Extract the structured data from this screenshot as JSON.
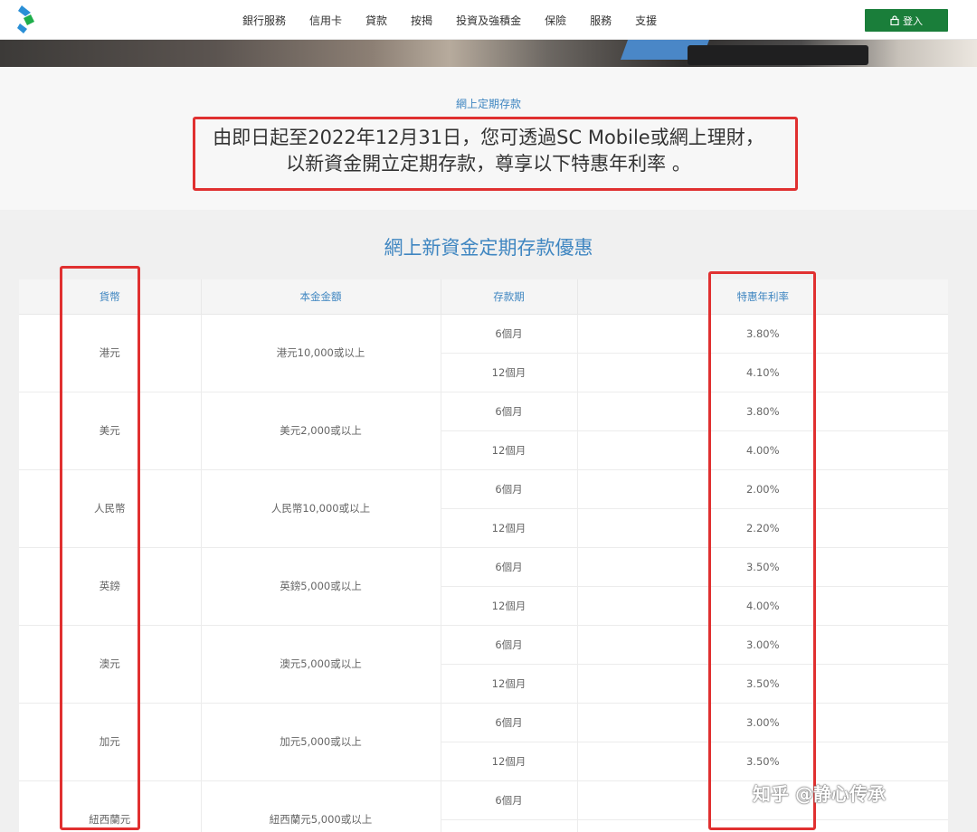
{
  "header": {
    "nav_items": [
      "銀行服務",
      "信用卡",
      "貸款",
      "按揭",
      "投資及強積金",
      "保險",
      "服務",
      "支援"
    ],
    "login_label": "登入",
    "logo_icon": "standard-chartered-logo-icon",
    "lock_icon": "lock-icon",
    "accent_color": "#1a7e3a"
  },
  "intro": {
    "breadcrumb": "網上定期存款",
    "announcement": "由即日起至2022年12月31日，您可透過SC Mobile或網上理財，以新資金開立定期存款，尊享以下特惠年利率 。"
  },
  "table": {
    "title": "網上新資金定期存款優惠",
    "headers": [
      "貨幣",
      "本金金額",
      "存款期",
      "特惠年利率"
    ],
    "rows": [
      {
        "currency": "港元",
        "principal": "港元10,000或以上",
        "terms": [
          {
            "term": "6個月",
            "rate": "3.80%"
          },
          {
            "term": "12個月",
            "rate": "4.10%"
          }
        ]
      },
      {
        "currency": "美元",
        "principal": "美元2,000或以上",
        "terms": [
          {
            "term": "6個月",
            "rate": "3.80%"
          },
          {
            "term": "12個月",
            "rate": "4.00%"
          }
        ]
      },
      {
        "currency": "人民幣",
        "principal": "人民幣10,000或以上",
        "terms": [
          {
            "term": "6個月",
            "rate": "2.00%"
          },
          {
            "term": "12個月",
            "rate": "2.20%"
          }
        ]
      },
      {
        "currency": "英鎊",
        "principal": "英鎊5,000或以上",
        "terms": [
          {
            "term": "6個月",
            "rate": "3.50%"
          },
          {
            "term": "12個月",
            "rate": "4.00%"
          }
        ]
      },
      {
        "currency": "澳元",
        "principal": "澳元5,000或以上",
        "terms": [
          {
            "term": "6個月",
            "rate": "3.00%"
          },
          {
            "term": "12個月",
            "rate": "3.50%"
          }
        ]
      },
      {
        "currency": "加元",
        "principal": "加元5,000或以上",
        "terms": [
          {
            "term": "6個月",
            "rate": "3.00%"
          },
          {
            "term": "12個月",
            "rate": "3.50%"
          }
        ]
      },
      {
        "currency": "紐西蘭元",
        "principal": "紐西蘭元5,000或以上",
        "terms": [
          {
            "term": "6個月",
            "rate": ""
          },
          {
            "term": "",
            "rate": ""
          }
        ]
      }
    ]
  },
  "annotations": {
    "highlight_color": "#e03030"
  },
  "watermark": {
    "text": "知乎 @静心传承"
  }
}
